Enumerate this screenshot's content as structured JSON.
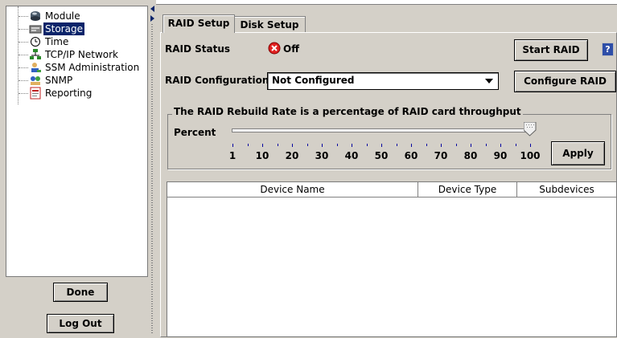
{
  "tree": {
    "items": [
      {
        "label": "Module"
      },
      {
        "label": "Storage"
      },
      {
        "label": "Time"
      },
      {
        "label": "TCP/IP Network"
      },
      {
        "label": "SSM Administration"
      },
      {
        "label": "SNMP"
      },
      {
        "label": "Reporting"
      }
    ],
    "selected": "Storage"
  },
  "left_buttons": {
    "done": "Done",
    "logout": "Log Out"
  },
  "tabs": [
    {
      "label": "RAID Setup",
      "active": true
    },
    {
      "label": "Disk Setup",
      "active": false
    }
  ],
  "raid": {
    "status_label": "RAID Status",
    "status_value": "Off",
    "status_color": "#e02020",
    "start_button": "Start RAID",
    "config_label": "RAID Configuration",
    "config_value": "Not Configured",
    "configure_button": "Configure RAID"
  },
  "rebuild": {
    "title": "The RAID Rebuild Rate is a percentage of RAID card throughput",
    "percent_label": "Percent",
    "value": 100,
    "ticks": [
      "1",
      "10",
      "20",
      "30",
      "40",
      "50",
      "60",
      "70",
      "80",
      "90",
      "100"
    ],
    "apply_button": "Apply"
  },
  "device_table": {
    "columns": [
      "Device Name",
      "Device Type",
      "Subdevices"
    ],
    "rows": []
  },
  "help_label": "?"
}
